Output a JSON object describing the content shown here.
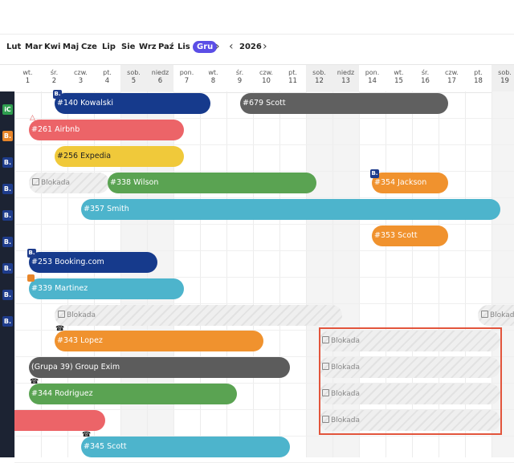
{
  "nav": {
    "months": [
      "Lut",
      "Mar",
      "Kwi",
      "Maj",
      "Cze",
      "Lip",
      "Sie",
      "Wrz",
      "Paź",
      "Lis",
      "Gru"
    ],
    "active_month": "Gru",
    "year": "2026"
  },
  "days": [
    {
      "dow": "wt.",
      "num": "1"
    },
    {
      "dow": "śr.",
      "num": "2"
    },
    {
      "dow": "czw.",
      "num": "3"
    },
    {
      "dow": "pt.",
      "num": "4"
    },
    {
      "dow": "sob.",
      "num": "5"
    },
    {
      "dow": "niedz",
      "num": "6"
    },
    {
      "dow": "pon.",
      "num": "7"
    },
    {
      "dow": "wt.",
      "num": "8"
    },
    {
      "dow": "śr.",
      "num": "9"
    },
    {
      "dow": "czw.",
      "num": "10"
    },
    {
      "dow": "pt.",
      "num": "11"
    },
    {
      "dow": "sob.",
      "num": "12"
    },
    {
      "dow": "niedz",
      "num": "13"
    },
    {
      "dow": "pon.",
      "num": "14"
    },
    {
      "dow": "wt.",
      "num": "15"
    },
    {
      "dow": "śr.",
      "num": "16"
    },
    {
      "dow": "czw.",
      "num": "17"
    },
    {
      "dow": "pt.",
      "num": "18"
    },
    {
      "dow": "sob.",
      "num": "19"
    }
  ],
  "sidebar_icons": [
    {
      "label": "iC",
      "color": "#2e9e4f"
    },
    {
      "label": "B.",
      "color": "#e8862a"
    },
    {
      "label": "B.",
      "color": "#1e3c8c"
    },
    {
      "label": "B.",
      "color": "#1e3c8c"
    },
    {
      "label": "B.",
      "color": "#1e3c8c"
    },
    {
      "label": "B.",
      "color": "#1e3c8c"
    },
    {
      "label": "B.",
      "color": "#1e3c8c"
    },
    {
      "label": "B.",
      "color": "#1e3c8c"
    },
    {
      "label": "B.",
      "color": "#1e3c8c"
    }
  ],
  "colors": {
    "navy": "#163a8c",
    "gray": "#606060",
    "red": "#ec6468",
    "yellow": "#f0c93a",
    "green": "#5aa352",
    "orange": "#f0922e",
    "teal": "#4db4cc",
    "darkgray": "#5c5c5c"
  },
  "bookings": [
    {
      "label": "#140 Kowalski",
      "color": "navy"
    },
    {
      "label": "#679 Scott",
      "color": "gray"
    },
    {
      "label": "#261 Airbnb",
      "color": "red"
    },
    {
      "label": "#256 Expedia",
      "color": "yellow"
    },
    {
      "label": "#338 Wilson",
      "color": "green"
    },
    {
      "label": "#354 Jackson",
      "color": "orange"
    },
    {
      "label": "#357 Smith",
      "color": "teal"
    },
    {
      "label": "#353 Scott",
      "color": "orange"
    },
    {
      "label": "#253 Booking.com",
      "color": "navy"
    },
    {
      "label": "#339 Martinez",
      "color": "teal"
    },
    {
      "label": "#343 Lopez",
      "color": "orange"
    },
    {
      "label": "(Grupa 39) Group Exim",
      "color": "darkgray"
    },
    {
      "label": "#344 Rodriguez",
      "color": "green"
    },
    {
      "label": "",
      "color": "red"
    },
    {
      "label": "#345 Scott",
      "color": "teal"
    }
  ],
  "blocks_label": "Blokada"
}
